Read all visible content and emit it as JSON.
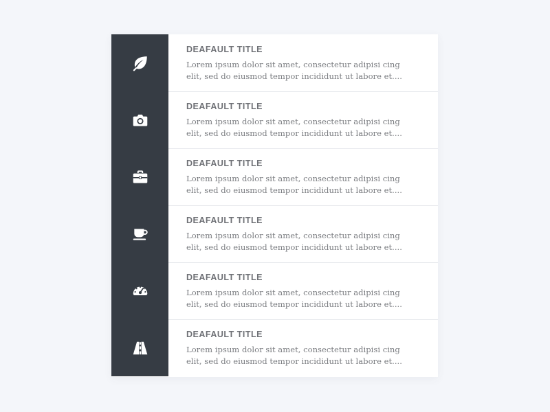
{
  "list": {
    "items": [
      {
        "icon": "leaf-icon",
        "title": "DEAFAULT TITLE",
        "description": "Lorem ipsum dolor sit amet, consectetur adipisi cing elit, sed do eiusmod tempor incididunt ut labore et...."
      },
      {
        "icon": "camera-icon",
        "title": "DEAFAULT TITLE",
        "description": "Lorem ipsum dolor sit amet, consectetur adipisi cing elit, sed do eiusmod tempor incididunt ut labore et...."
      },
      {
        "icon": "briefcase-icon",
        "title": "DEAFAULT TITLE",
        "description": "Lorem ipsum dolor sit amet, consectetur adipisi cing elit, sed do eiusmod tempor incididunt ut labore et...."
      },
      {
        "icon": "coffee-cup-icon",
        "title": "DEAFAULT TITLE",
        "description": "Lorem ipsum dolor sit amet, consectetur adipisi cing elit, sed do eiusmod tempor incididunt ut labore et...."
      },
      {
        "icon": "speedometer-icon",
        "title": "DEAFAULT TITLE",
        "description": "Lorem ipsum dolor sit amet, consectetur adipisi cing elit, sed do eiusmod tempor incididunt ut labore et...."
      },
      {
        "icon": "road-icon",
        "title": "DEAFAULT TITLE",
        "description": "Lorem ipsum dolor sit amet, consectetur adipisi cing elit, sed do eiusmod tempor incididunt ut labore et...."
      }
    ]
  },
  "colors": {
    "background": "#f4f6fa",
    "icon_column": "#363c44",
    "card": "#ffffff",
    "title_text": "#6e7075",
    "body_text": "#7a7c80",
    "divider": "#e6e8ec"
  }
}
